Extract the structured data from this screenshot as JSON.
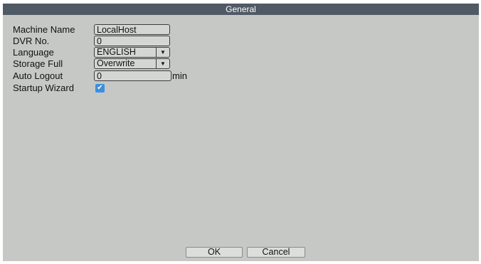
{
  "window": {
    "title": "General"
  },
  "form": {
    "machine_name": {
      "label": "Machine Name",
      "value": "LocalHost"
    },
    "dvr_no": {
      "label": "DVR No.",
      "value": "0"
    },
    "language": {
      "label": "Language",
      "value": "ENGLISH"
    },
    "storage_full": {
      "label": "Storage Full",
      "value": "Overwrite"
    },
    "auto_logout": {
      "label": "Auto Logout",
      "value": "0",
      "unit": "min"
    },
    "startup_wizard": {
      "label": "Startup Wizard",
      "checked": true
    }
  },
  "buttons": {
    "ok": "OK",
    "cancel": "Cancel"
  },
  "colors": {
    "titlebar": "#505a65",
    "panel": "#c6c8c6",
    "checkbox": "#3c8fdf"
  },
  "icons": {
    "dropdown": "chevron-down-icon",
    "check": "checkmark-icon"
  }
}
